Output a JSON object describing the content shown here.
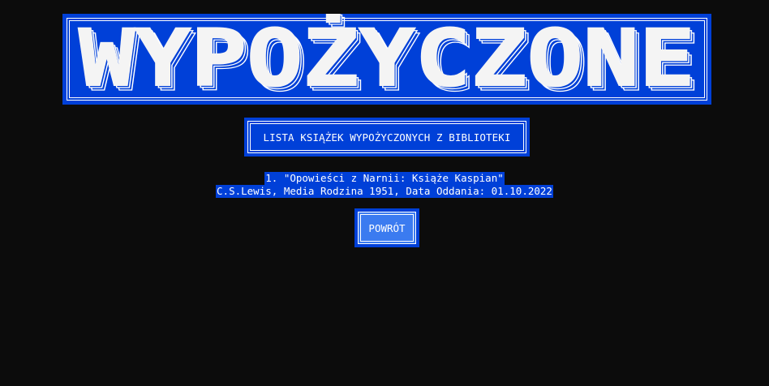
{
  "header": {
    "title": "WYPOŻYCZONE"
  },
  "subtitle": {
    "label": "LISTA KSIĄŻEK WYPOŻYCZONYCH Z BIBLIOTEKI"
  },
  "books": [
    {
      "line1": "1. \"Opowieści z Narnii: Książe Kaspian\"",
      "line2": "C.S.Lewis, Media Rodzina 1951, Data Oddania: 01.10.2022"
    }
  ],
  "actions": {
    "back_label": "POWRÓT"
  },
  "colors": {
    "background": "#0c0c0c",
    "accent": "#0040d8",
    "button_face": "#3b7bf0",
    "text": "#ffffff"
  }
}
